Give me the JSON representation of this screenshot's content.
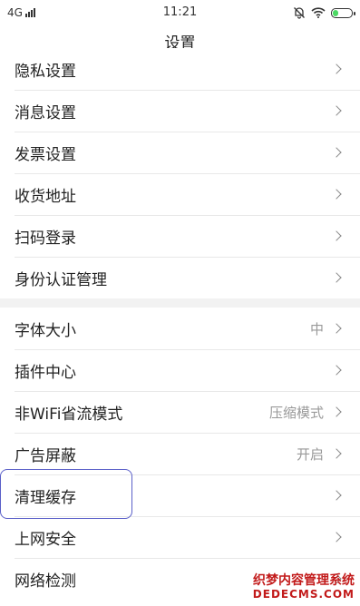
{
  "status_bar": {
    "network": "4G",
    "time": "11:21",
    "icons": [
      "signal-icon",
      "mute-bell-icon",
      "wifi-icon",
      "battery-icon"
    ],
    "battery_color": "#4cd964"
  },
  "header": {
    "title": "设置"
  },
  "group1": {
    "items": [
      {
        "label": "隐私设置"
      },
      {
        "label": "消息设置"
      },
      {
        "label": "发票设置"
      },
      {
        "label": "收货地址"
      },
      {
        "label": "扫码登录"
      },
      {
        "label": "身份认证管理"
      }
    ]
  },
  "group2": {
    "items": [
      {
        "label": "字体大小",
        "value": "中"
      },
      {
        "label": "插件中心",
        "value": ""
      },
      {
        "label": "非WiFi省流模式",
        "value": "压缩模式"
      },
      {
        "label": "广告屏蔽",
        "value": "开启"
      },
      {
        "label": "清理缓存",
        "value": ""
      },
      {
        "label": "上网安全",
        "value": ""
      },
      {
        "label": "网络检测",
        "value": ""
      }
    ]
  },
  "highlight_color": "#5a5fc8",
  "watermark": {
    "line1": "织梦内容管理系统",
    "line2": "DEDECMS.COM"
  }
}
